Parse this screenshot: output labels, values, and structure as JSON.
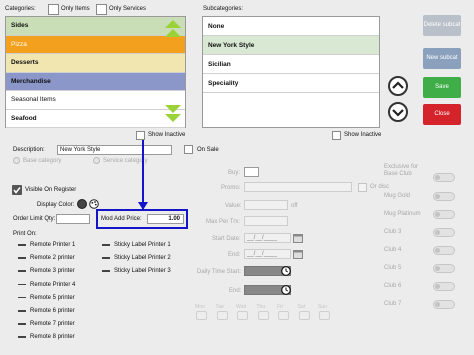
{
  "categories": {
    "label": "Categories:",
    "only_items": "Only Items",
    "only_services": "Only Services",
    "items": [
      {
        "label": "Sides",
        "bg": "#c9ddb7",
        "bold": true
      },
      {
        "label": "Pizza",
        "bg": "#f2a01d",
        "bold": false
      },
      {
        "label": "Desserts",
        "bg": "#f1e5b0",
        "bold": true
      },
      {
        "label": "Merchandise",
        "bg": "#8b96c9",
        "bold": true
      },
      {
        "label": "Seasonal Items",
        "bg": "#ffffff",
        "bold": false
      },
      {
        "label": "Seafood",
        "bg": "#ffffff",
        "bold": true
      }
    ],
    "show_inactive": "Show Inactive"
  },
  "subcategories": {
    "label": "Subcategories:",
    "items": [
      {
        "label": "None",
        "selected": false
      },
      {
        "label": "New York Style",
        "selected": true
      },
      {
        "label": "Sicilian",
        "selected": false
      },
      {
        "label": "Speciality",
        "selected": false
      }
    ],
    "show_inactive": "Show Inactive"
  },
  "buttons": {
    "delete_subcat": "Delete subcat",
    "new_subcat": "New subcat",
    "save": "Save",
    "close": "Close"
  },
  "form": {
    "description_label": "Description:",
    "description_value": "New York Style",
    "on_sale": "On Sale",
    "radio_base": "Base category",
    "radio_service": "Service category",
    "visible_on_register": "Visible On Register",
    "display_color": "Display Color:",
    "order_limit_qty": "Order Limit Qty:",
    "mod_add_price_label": "Mod Add  Price:",
    "mod_add_price_value": "1.00",
    "print_on": "Print On:",
    "printers": [
      "Remote Printer 1",
      "Remote 2 printer",
      "Remote 3 printer",
      "Remote Printer 4",
      "Remote 5 printer",
      "Remote 6 printer",
      "Remote 7 printer",
      "Remote 8 printer"
    ],
    "sticky_printers": [
      "Sticky Label Printer 1",
      "Sticky Label Printer 2",
      "Sticky Label Printer 3"
    ]
  },
  "middle": {
    "buy": "Buy:",
    "promo": "Promo:",
    "value": "Value:",
    "value_suffix": "off",
    "max_per_trx": "Max Per Trx:",
    "start_date": "Start Date:",
    "start_date_value": "__/__/____",
    "end": "End:",
    "end_date_value": "__/__/____",
    "daily_time_start": "Daily Time Start:",
    "end_time": "End:",
    "or_label": "Or disc",
    "days": [
      "Mon",
      "Tue",
      "Wed",
      "Thu",
      "Fri",
      "Sat",
      "Sun"
    ]
  },
  "clubs": {
    "title": "Exclusive for Base Club",
    "items": [
      "Mug Gold",
      "Mug Platinum",
      "Club 3",
      "Club 4",
      "Club 5",
      "Club 6",
      "Club 7"
    ]
  },
  "colors": {
    "delete": "#b9c0c9",
    "new": "#8aa0bd",
    "save": "#3fae49",
    "close": "#d5232b",
    "highlight": "#1414c8",
    "selected_sub": "#d8e8d2"
  },
  "icons": [
    "triangle-up-icon",
    "triangle-down-icon",
    "chevron-up-icon",
    "chevron-down-icon",
    "palette-icon",
    "clock-icon",
    "calendar-icon"
  ]
}
